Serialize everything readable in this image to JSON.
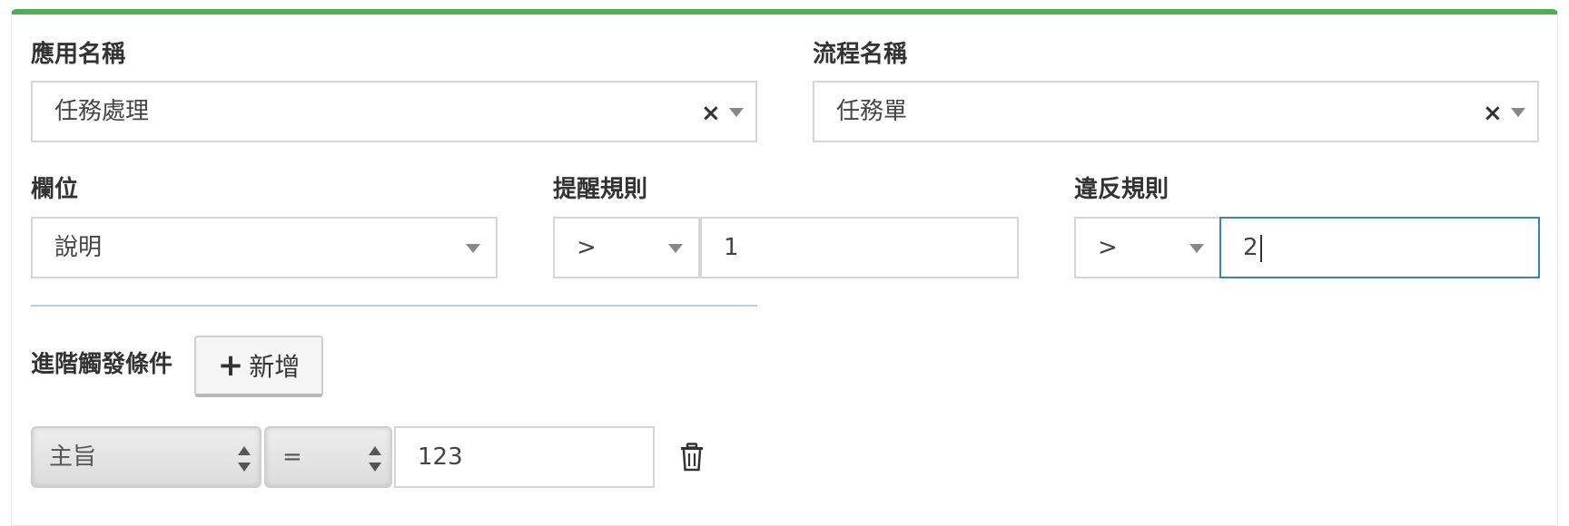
{
  "app_name": {
    "label": "應用名稱",
    "value": "任務處理"
  },
  "flow_name": {
    "label": "流程名稱",
    "value": "任務單"
  },
  "field": {
    "label": "欄位",
    "value": "說明"
  },
  "remind_rule": {
    "label": "提醒規則",
    "operator": ">",
    "value": "1"
  },
  "violate_rule": {
    "label": "違反規則",
    "operator": ">",
    "value": "2"
  },
  "advanced": {
    "label": "進階觸發條件",
    "add_button": "新增"
  },
  "condition_row": {
    "field": "主旨",
    "operator": "=",
    "value": "123"
  },
  "icons": {
    "clear": "×",
    "plus": "+",
    "delete": "trash-icon"
  },
  "colors": {
    "accent_top": "#4caf50",
    "focus_border": "#3b7fc4"
  }
}
